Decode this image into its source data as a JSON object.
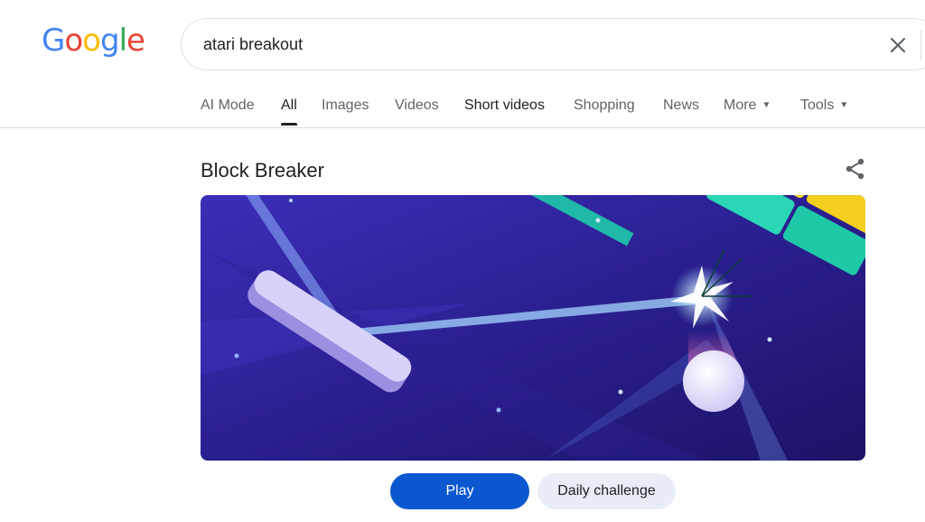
{
  "logo": {
    "text": "Google",
    "letters": [
      {
        "ch": "G",
        "color": "#4285F4"
      },
      {
        "ch": "o",
        "color": "#EA4335"
      },
      {
        "ch": "o",
        "color": "#FBBC05"
      },
      {
        "ch": "g",
        "color": "#4285F4"
      },
      {
        "ch": "l",
        "color": "#34A853"
      },
      {
        "ch": "e",
        "color": "#EA4335"
      }
    ]
  },
  "search": {
    "query": "atari breakout",
    "clear_icon": "close-icon"
  },
  "tabs": [
    {
      "label": "AI Mode"
    },
    {
      "label": "All",
      "active": true
    },
    {
      "label": "Images"
    },
    {
      "label": "Videos"
    },
    {
      "label": "Short videos"
    },
    {
      "label": "Shopping"
    },
    {
      "label": "News"
    },
    {
      "label": "More",
      "dropdown": true
    },
    {
      "label": "Tools",
      "dropdown": true
    }
  ],
  "card": {
    "title": "Block Breaker",
    "share_icon": "share-icon",
    "play_label": "Play",
    "daily_label": "Daily challenge"
  },
  "colors": {
    "primary_button": "#0b57d0",
    "secondary_button": "#e8edf8"
  }
}
